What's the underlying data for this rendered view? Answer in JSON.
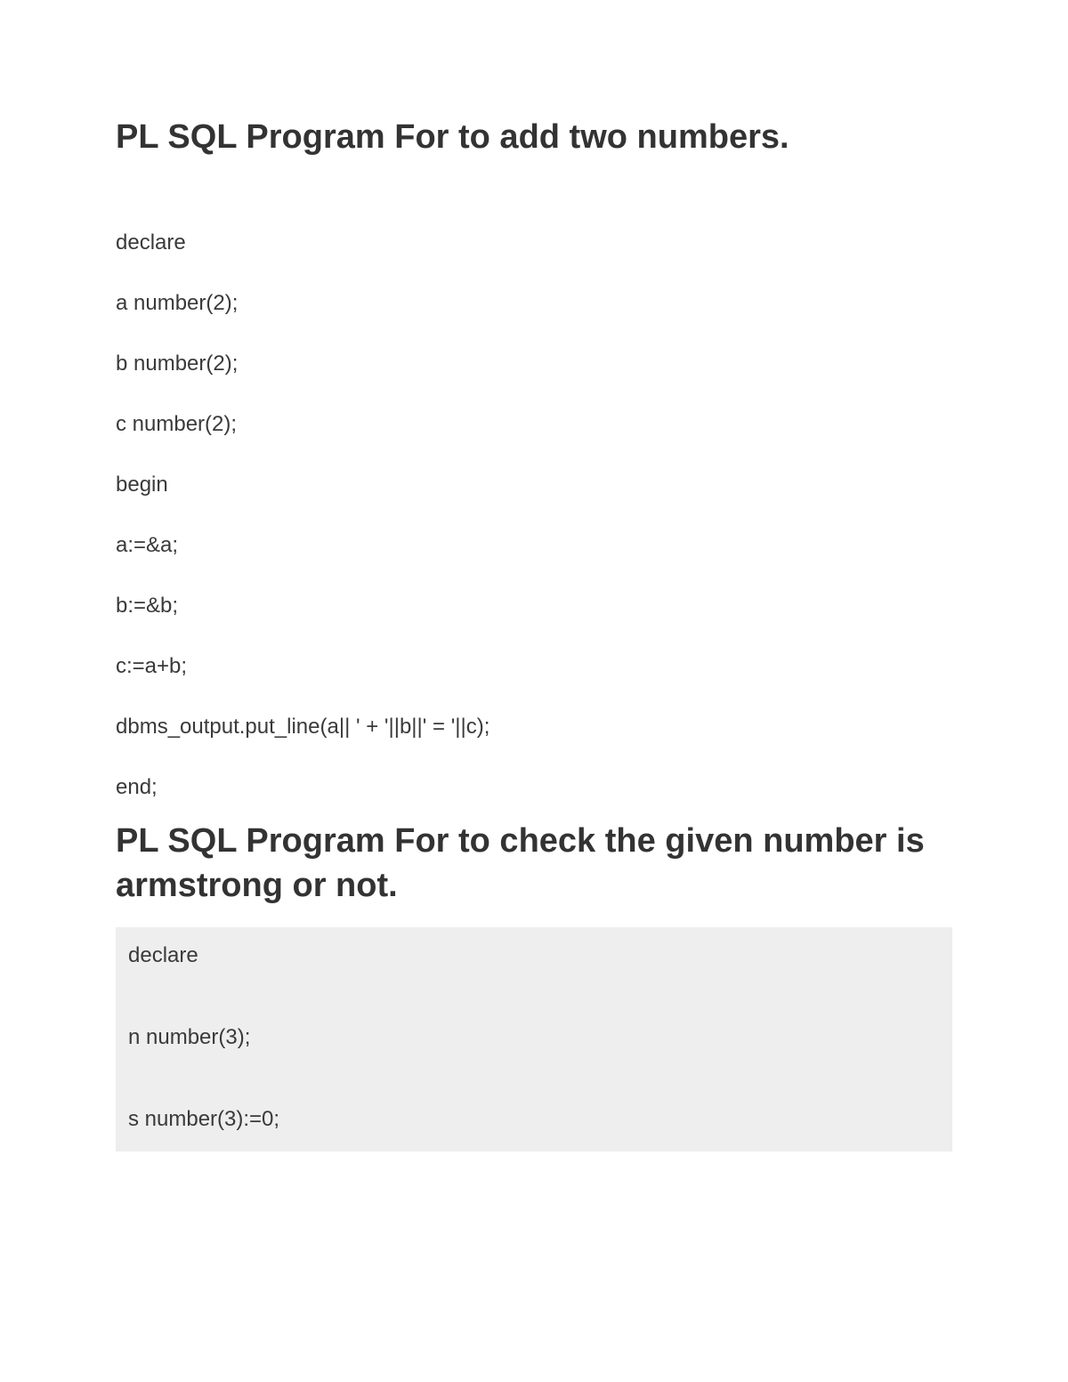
{
  "section1": {
    "heading": "PL SQL Program For to add two numbers.",
    "code": [
      "declare",
      "a number(2);",
      "b number(2);",
      "c number(2);",
      "begin",
      "a:=&a;",
      "b:=&b;",
      "c:=a+b;",
      "dbms_output.put_line(a|| ' + '||b||' = '||c);",
      "end;"
    ]
  },
  "section2": {
    "heading": "PL SQL Program For to check the given number is armstrong or not.",
    "code": [
      "declare",
      "n number(3);",
      "s number(3):=0;"
    ]
  }
}
